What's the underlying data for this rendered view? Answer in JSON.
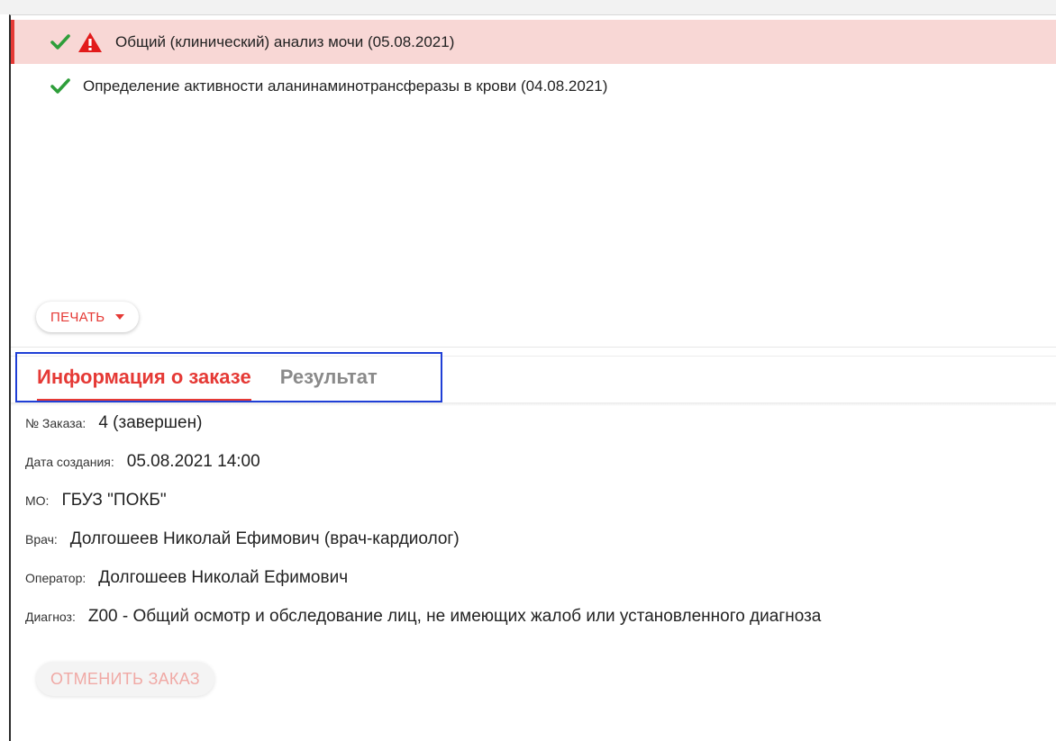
{
  "analyses": [
    {
      "label": "Общий (клинический) анализ мочи (05.08.2021)",
      "selected": true,
      "status_icon": "check-icon",
      "warning_icon": "warning-triangle-icon"
    },
    {
      "label": "Определение активности аланинаминотрансферазы в крови (04.08.2021)",
      "selected": false,
      "status_icon": "check-icon"
    }
  ],
  "print_button": {
    "label": "ПЕЧАТЬ",
    "icon": "caret-down-icon"
  },
  "tabs": [
    {
      "label": "Информация о заказе",
      "active": true
    },
    {
      "label": "Результат",
      "active": false
    }
  ],
  "order_info": {
    "order_number": {
      "label": "№ Заказа:",
      "value": "4 (завершен)"
    },
    "created": {
      "label": "Дата создания:",
      "value": "05.08.2021 14:00"
    },
    "mo": {
      "label": "МО:",
      "value": "ГБУЗ \"ПОКБ\""
    },
    "doctor": {
      "label": "Врач:",
      "value": "Долгошеев Николай Ефимович (врач-кардиолог)"
    },
    "operator": {
      "label": "Оператор:",
      "value": "Долгошеев Николай Ефимович"
    },
    "diagnosis": {
      "label": "Диагноз:",
      "value": "Z00 - Общий осмотр и обследование лиц, не имеющих жалоб или установленного диагноза"
    }
  },
  "cancel_button": {
    "label": "ОТМЕНИТЬ ЗАКАЗ"
  },
  "colors": {
    "accent": "#e53935",
    "check": "#2e9e3a",
    "selected_row": "#f8d7d5",
    "tab_highlight_border": "#1f3fd6"
  }
}
